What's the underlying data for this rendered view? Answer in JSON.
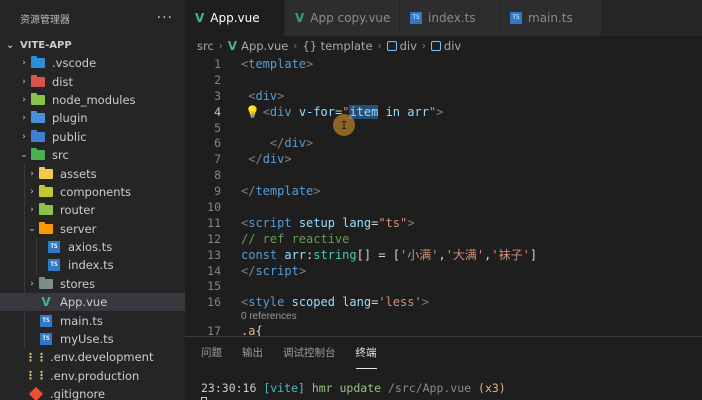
{
  "explorer": {
    "title": "资源管理器",
    "more": "···",
    "project": "VITE-APP"
  },
  "tree": [
    {
      "label": ".vscode",
      "kind": "folder-vscode",
      "chevron": "›"
    },
    {
      "label": "dist",
      "kind": "folder-dist",
      "chevron": "›"
    },
    {
      "label": "node_modules",
      "kind": "folder-node",
      "chevron": "›"
    },
    {
      "label": "plugin",
      "kind": "folder-plugin",
      "chevron": "›"
    },
    {
      "label": "public",
      "kind": "folder-public",
      "chevron": "›"
    },
    {
      "label": "src",
      "kind": "folder-src",
      "chevron": "⌄"
    },
    {
      "label": "assets",
      "kind": "folder-assets",
      "chevron": "›"
    },
    {
      "label": "components",
      "kind": "folder-components",
      "chevron": "›"
    },
    {
      "label": "router",
      "kind": "folder-router",
      "chevron": "›"
    },
    {
      "label": "server",
      "kind": "folder-server",
      "chevron": "⌄"
    },
    {
      "label": "axios.ts",
      "kind": "ts-file",
      "chevron": ""
    },
    {
      "label": "index.ts",
      "kind": "ts-file",
      "chevron": ""
    },
    {
      "label": "stores",
      "kind": "folder-stores",
      "chevron": "›"
    },
    {
      "label": "App.vue",
      "kind": "vue-file",
      "chevron": ""
    },
    {
      "label": "main.ts",
      "kind": "ts-file",
      "chevron": ""
    },
    {
      "label": "myUse.ts",
      "kind": "ts-file",
      "chevron": ""
    },
    {
      "label": ".env.development",
      "kind": "env-file",
      "chevron": ""
    },
    {
      "label": ".env.production",
      "kind": "env-file",
      "chevron": ""
    },
    {
      "label": ".gitignore",
      "kind": "git-file",
      "chevron": ""
    }
  ],
  "tabs": [
    {
      "label": "App.vue",
      "icon": "vue-icon",
      "active": true,
      "modified": true
    },
    {
      "label": "App copy.vue",
      "icon": "vue-icon",
      "active": false
    },
    {
      "label": "index.ts",
      "icon": "ts-icon",
      "active": false
    },
    {
      "label": "main.ts",
      "icon": "ts-icon",
      "active": false
    }
  ],
  "breadcrumb": {
    "src": "src",
    "file": "App.vue",
    "template": "{} template",
    "div1": "div",
    "div2": "div"
  },
  "editor": {
    "line_numbers": [
      "1",
      "2",
      "3",
      "4",
      "5",
      "6",
      "7",
      "8",
      "9",
      "10",
      "11",
      "12",
      "13",
      "14",
      "15",
      "16",
      "17"
    ],
    "current_line": "4",
    "codelens": "0 references"
  },
  "panel": {
    "tabs": [
      "问题",
      "输出",
      "调试控制台",
      "终端"
    ],
    "active_tab": "终端",
    "terminal": {
      "time": "23:30:16",
      "vite": "[vite]",
      "hmr": "hmr update",
      "path": "/src/App.vue",
      "count": "(x3)"
    }
  },
  "colors": {
    "vue": "#41b883",
    "ts": "#3178c6",
    "accent": "#007acc",
    "selection": "#264f78"
  }
}
